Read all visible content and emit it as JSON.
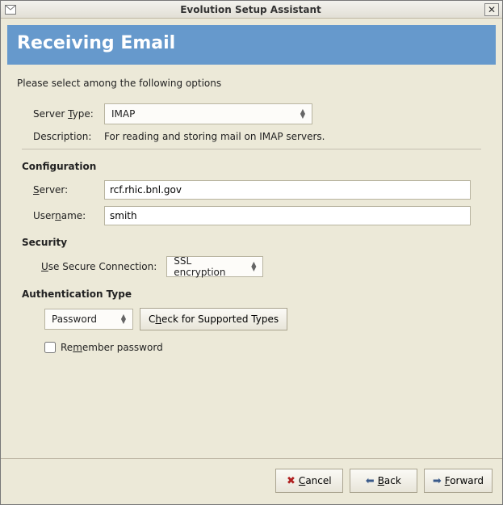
{
  "window": {
    "title": "Evolution Setup Assistant"
  },
  "hero": {
    "title": "Receiving Email"
  },
  "intro": "Please select among the following options",
  "serverType": {
    "label": "Server Type:",
    "selected": "IMAP"
  },
  "description": {
    "label": "Description:",
    "text": "For reading and storing mail on IMAP servers."
  },
  "sections": {
    "configuration": "Configuration",
    "security": "Security",
    "authType": "Authentication Type"
  },
  "config": {
    "serverLabel": "Server:",
    "serverAccess": "S",
    "serverValue": "rcf.rhic.bnl.gov",
    "usernameLabelPre": "User",
    "usernameAccess": "n",
    "usernameLabelPost": "ame:",
    "usernameValue": "smith"
  },
  "security": {
    "labelAccess": "U",
    "labelRest": "se Secure Connection:",
    "selected": "SSL encryption"
  },
  "auth": {
    "selected": "Password",
    "checkLabelPre": "C",
    "checkLabelAccess": "h",
    "checkLabelPost": "eck for Supported Types"
  },
  "remember": {
    "pre": "Re",
    "access": "m",
    "post": "ember password",
    "checked": false
  },
  "buttons": {
    "cancelAccess": "C",
    "cancelRest": "ancel",
    "backAccess": "B",
    "backRest": "ack",
    "forwardAccess": "F",
    "forwardRest": "orward"
  }
}
